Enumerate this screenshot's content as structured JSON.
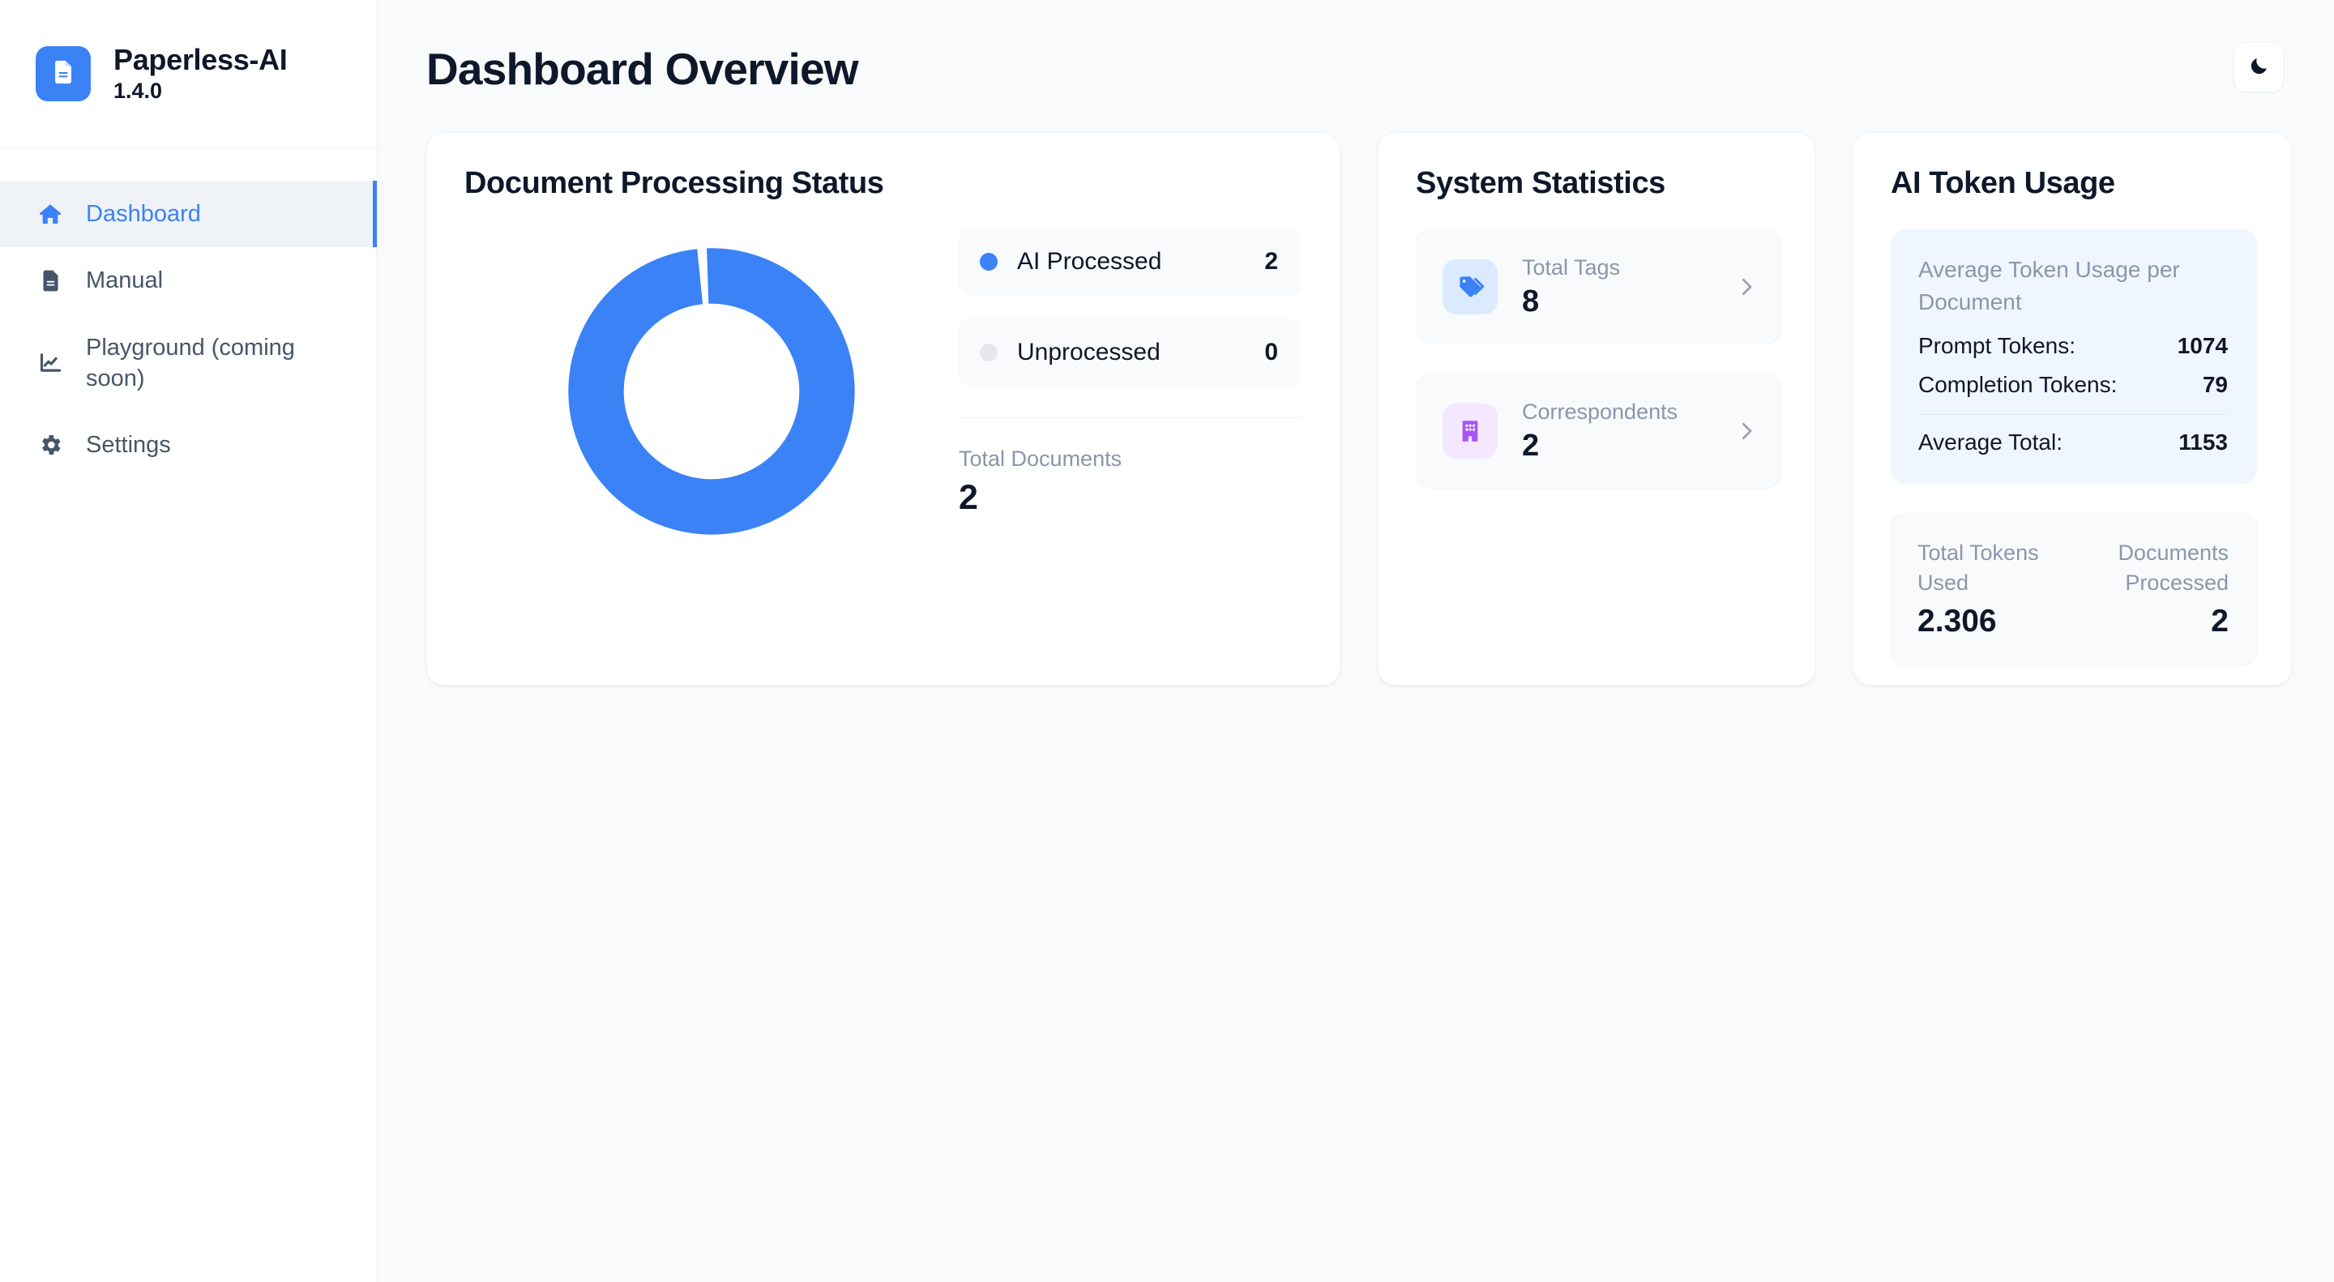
{
  "brand": {
    "name": "Paperless-AI",
    "version": "1.4.0",
    "logo_icon": "document-icon"
  },
  "sidebar": {
    "items": [
      {
        "label": "Dashboard",
        "icon": "home-icon",
        "active": true
      },
      {
        "label": "Manual",
        "icon": "document-icon",
        "active": false
      },
      {
        "label": "Playground (coming soon)",
        "icon": "chart-line-icon",
        "active": false
      },
      {
        "label": "Settings",
        "icon": "gear-icon",
        "active": false
      }
    ]
  },
  "header": {
    "title": "Dashboard Overview",
    "theme_toggle_icon": "moon-icon"
  },
  "processing_card": {
    "title": "Document Processing Status",
    "legend": [
      {
        "label": "AI Processed",
        "value": "2",
        "color": "#3b82f6"
      },
      {
        "label": "Unprocessed",
        "value": "0",
        "color": "#e5e7eb"
      }
    ],
    "total_label": "Total Documents",
    "total_value": "2"
  },
  "stats_card": {
    "title": "System Statistics",
    "rows": [
      {
        "label": "Total Tags",
        "value": "8",
        "icon": "tag-icon",
        "icon_bg": "#dbeafe",
        "icon_color": "#3b82f6",
        "chevron": "chevron-right-icon"
      },
      {
        "label": "Correspondents",
        "value": "2",
        "icon": "building-icon",
        "icon_bg": "#f3e8ff",
        "icon_color": "#a855f7",
        "chevron": "chevron-right-icon"
      }
    ]
  },
  "tokens_card": {
    "title": "AI Token Usage",
    "panel_title": "Average Token Usage per Document",
    "rows": [
      {
        "key": "Prompt Tokens:",
        "value": "1074"
      },
      {
        "key": "Completion Tokens:",
        "value": "79"
      }
    ],
    "average_total_key": "Average Total:",
    "average_total_value": "1153",
    "summary": {
      "left_label": "Total Tokens Used",
      "left_value": "2.306",
      "right_label": "Documents Processed",
      "right_value": "2"
    }
  },
  "chart_data": {
    "type": "pie",
    "title": "Document Processing Status",
    "subtype": "donut",
    "categories": [
      "AI Processed",
      "Unprocessed"
    ],
    "values": [
      2,
      0
    ],
    "percentages": [
      100,
      0
    ],
    "colors": [
      "#3b82f6",
      "#e5e7eb"
    ],
    "total": 2,
    "total_label": "Total Documents",
    "legend_position": "right",
    "inner_radius_ratio": 0.62,
    "grid": false
  }
}
